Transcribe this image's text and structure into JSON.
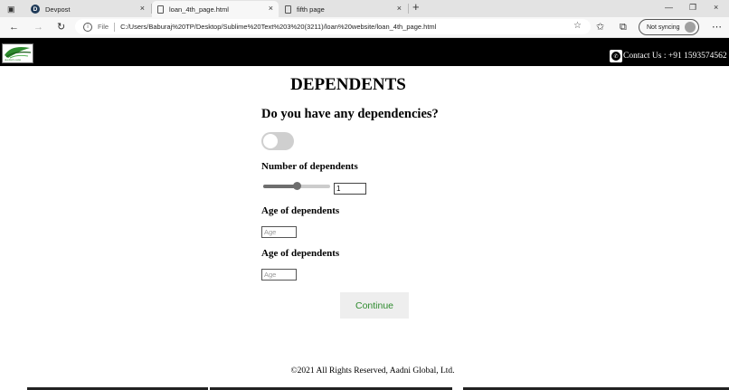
{
  "browser": {
    "tabs": [
      {
        "title": "Devpost",
        "favicon": "D"
      },
      {
        "title": "loan_4th_page.html"
      },
      {
        "title": "fifth page"
      }
    ],
    "new_tab_glyph": "+",
    "close_glyph": "×",
    "address": {
      "scheme_label": "File",
      "url": "C:/Users/Baburaj%20TP/Desktop/Sublime%20Text%203%20(3211)/loan%20website/loan_4th_page.html"
    },
    "sync_label": "Not syncing",
    "icons": {
      "back": "arrow-left-icon",
      "forward": "arrow-right-icon",
      "reload": "reload-icon",
      "favorites_add": "star-add-icon",
      "favorites": "favorites-icon",
      "collections": "collections-icon",
      "more": "more-icon"
    }
  },
  "page": {
    "logo_text": "Aadni Loans",
    "contact": "Contact Us : +91 1593574562",
    "title": "DEPENDENTS",
    "question": "Do you have any dependencies?",
    "toggle_on": false,
    "dependents_label": "Number of dependents",
    "slider_fraction": 0.5,
    "dependents_value": "1",
    "age_fields": [
      {
        "label": "Age of dependents",
        "placeholder": "Age"
      },
      {
        "label": "Age of dependents",
        "placeholder": "Age"
      }
    ],
    "continue_label": "Continue",
    "footer": "©2021 All Rights Reserved, Aadni Global, Ltd.",
    "colors": {
      "navbar": "#000000",
      "continue_text": "#2e8b2e",
      "toggle_track": "#cfcfcf",
      "slider_fill": "#6e6e6e"
    }
  }
}
